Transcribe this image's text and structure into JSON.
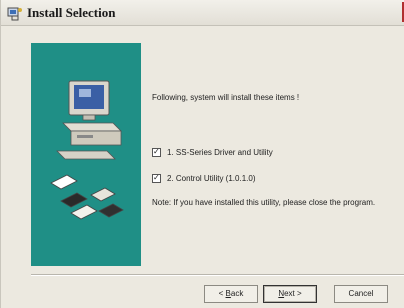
{
  "window": {
    "title": "Install Selection"
  },
  "main": {
    "intro": "Following, system will install these items !",
    "items": [
      {
        "label": "1. SS-Series Driver and Utility",
        "checked": true
      },
      {
        "label": "2. Control  Utility  (1.0.1.0)",
        "checked": true
      }
    ],
    "note": "Note: If you have installed this utility, please close the program."
  },
  "buttons": {
    "back_prefix": "< ",
    "back_accel": "B",
    "back_rest": "ack",
    "next_accel": "N",
    "next_rest": "ext >",
    "cancel": "Cancel"
  },
  "colors": {
    "panel": "#1f8f86",
    "dialog": "#ece9e0"
  }
}
